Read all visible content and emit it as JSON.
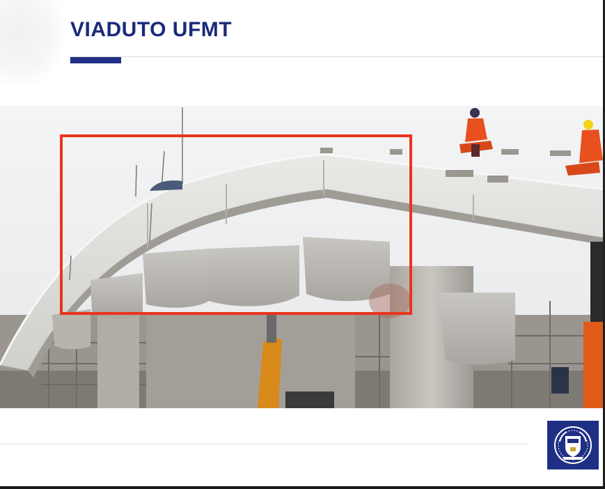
{
  "slide": {
    "title": "VIADUTO UFMT"
  },
  "photo": {
    "image_icon": "bridge-construction-photo"
  },
  "logo": {
    "icon": "university-coat-of-arms-icon"
  },
  "colors": {
    "title": "#1a2a7a",
    "accent_bar": "#1f2f86",
    "highlight": "#e8351c",
    "logo_bg": "#1f2f86"
  }
}
